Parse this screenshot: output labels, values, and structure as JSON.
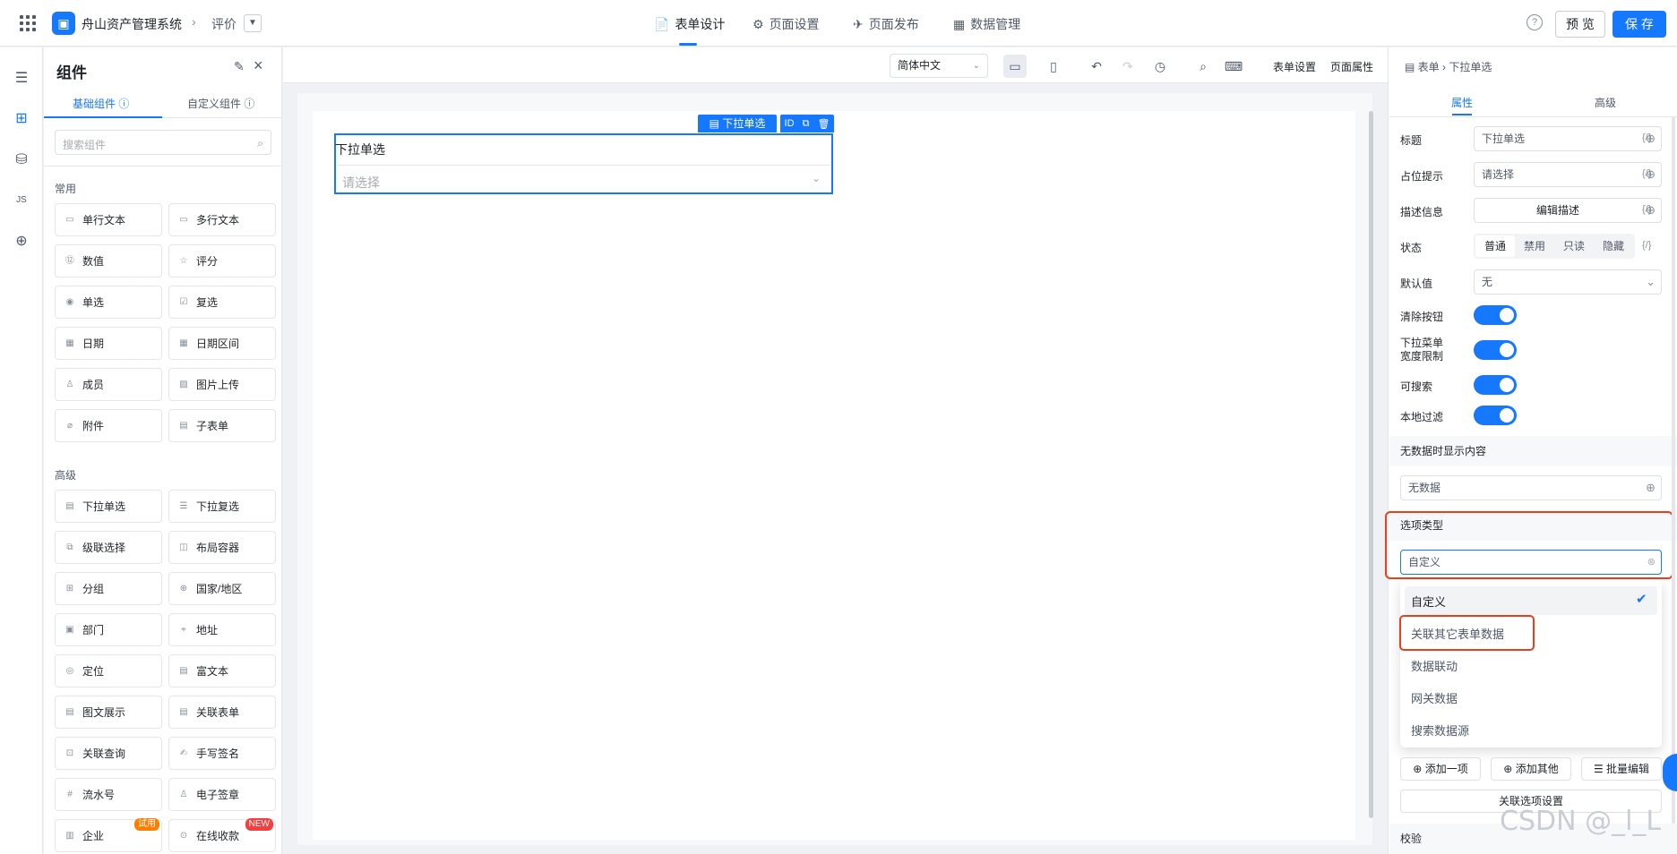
{
  "header": {
    "app_name": "舟山资产管理系统",
    "crumb_sep": "›",
    "page_name": "评价",
    "tabs": [
      {
        "label": "表单设计",
        "icon": "📄"
      },
      {
        "label": "页面设置",
        "icon": "⚙"
      },
      {
        "label": "页面发布",
        "icon": "✈"
      },
      {
        "label": "数据管理",
        "icon": "▦"
      }
    ],
    "help": "?",
    "preview": "预 览",
    "save": "保 存"
  },
  "components": {
    "title": "组件",
    "tabs": [
      "基础组件",
      "自定义组件"
    ],
    "search_placeholder": "搜索组件",
    "sections": [
      {
        "title": "常用",
        "items": [
          "单行文本",
          "多行文本",
          "数值",
          "评分",
          "单选",
          "复选",
          "日期",
          "日期区间",
          "成员",
          "图片上传",
          "附件",
          "子表单"
        ]
      },
      {
        "title": "高级",
        "items": [
          "下拉单选",
          "下拉复选",
          "级联选择",
          "布局容器",
          "分组",
          "国家/地区",
          "部门",
          "地址",
          "定位",
          "富文本",
          "图文展示",
          "关联表单",
          "关联查询",
          "手写签名",
          "流水号",
          "电子签章",
          "企业",
          "在线收款"
        ]
      }
    ],
    "tags": {
      "trial": "试用",
      "new": "NEW"
    }
  },
  "toolbar": {
    "language": "简体中文",
    "form_settings": "表单设置",
    "page_props": "页面属性"
  },
  "canvas": {
    "field_label": "下拉单选",
    "field_placeholder": "请选择",
    "chip_label": "下拉单选",
    "id_label": "ID"
  },
  "properties": {
    "breadcrumb": [
      "表单",
      "下拉单选"
    ],
    "tabs": [
      "属性",
      "高级"
    ],
    "title_label": "标题",
    "title_value": "下拉单选",
    "placeholder_label": "占位提示",
    "placeholder_value": "请选择",
    "desc_label": "描述信息",
    "desc_button": "编辑描述",
    "status_label": "状态",
    "status_options": [
      "普通",
      "禁用",
      "只读",
      "隐藏"
    ],
    "default_label": "默认值",
    "default_value": "无",
    "clear_label": "清除按钮",
    "width_label_1": "下拉菜单",
    "width_label_2": "宽度限制",
    "search_label": "可搜索",
    "local_filter_label": "本地过滤",
    "no_data_section": "无数据时显示内容",
    "no_data_value": "无数据",
    "option_type_section": "选项类型",
    "option_type_value": "自定义",
    "dropdown_options": [
      "自定义",
      "关联其它表单数据",
      "数据联动",
      "网关数据",
      "搜索数据源"
    ],
    "add_one": "添加一项",
    "add_other": "添加其他",
    "batch_edit": "批量编辑",
    "link_settings": "关联选项设置",
    "validate_section": "校验",
    "fx": "{/}"
  },
  "watermark": "CSDN @_l_L"
}
